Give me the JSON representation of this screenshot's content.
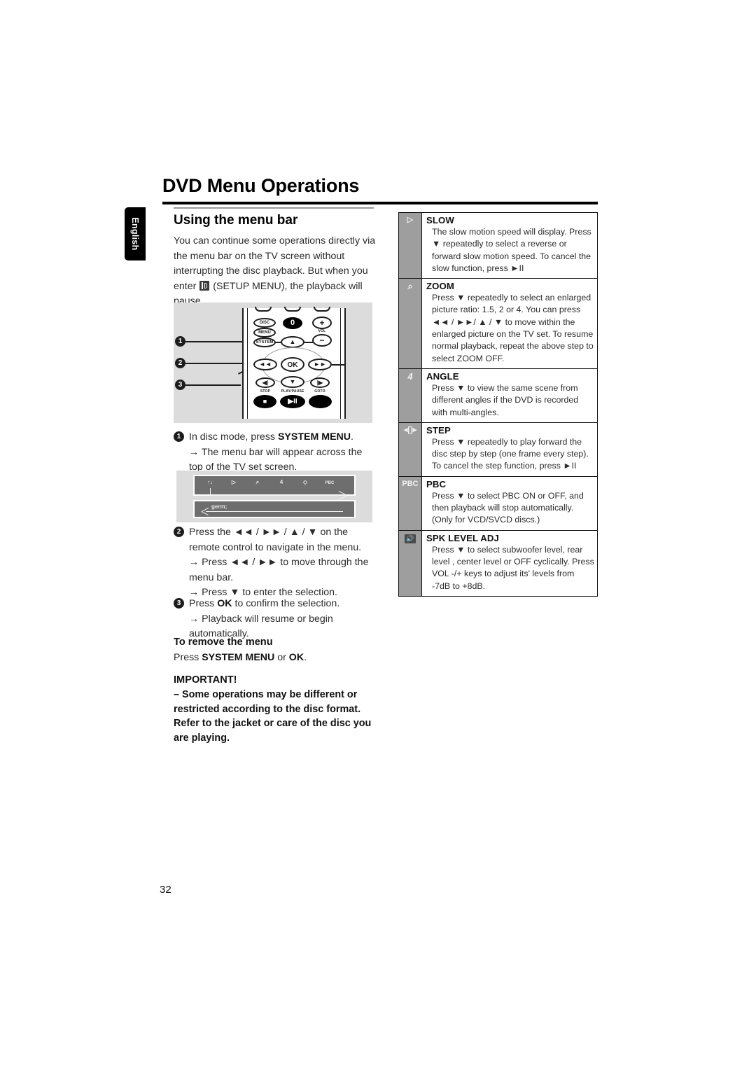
{
  "sidebar": {
    "language_tab": "English"
  },
  "header": {
    "title": "DVD Menu Operations"
  },
  "left": {
    "section_heading": "Using the menu bar",
    "intro_part1": "You can continue some operations directly via the menu bar on the TV screen without interrupting the disc playback. But when you enter",
    "intro_icon": "setup-menu-icon",
    "intro_part2": "(SETUP MENU), the playback will pause.",
    "remote_figure": {
      "name": "remote-control-illustration",
      "callouts": [
        "1",
        "2",
        "3"
      ],
      "buttons": [
        {
          "label": "DISC"
        },
        {
          "label": "MENU"
        },
        {
          "label": "SYSTEM"
        },
        {
          "label": "0"
        },
        {
          "label": "+"
        },
        {
          "label": "VOL"
        },
        {
          "label": "−"
        },
        {
          "label": "▲"
        },
        {
          "label": "◄◄"
        },
        {
          "label": "OK"
        },
        {
          "label": "►►"
        },
        {
          "label": "►►"
        },
        {
          "label": "▼"
        },
        {
          "label": "►▌"
        },
        {
          "label": "STOP"
        },
        {
          "label": "PLAY/PAUSE"
        },
        {
          "label": "GOTO"
        }
      ]
    },
    "steps": [
      {
        "num": "1",
        "text_main_pre": "In disc mode, press ",
        "text_main_bold": "SYSTEM MENU",
        "text_main_post": ".",
        "sub": [
          "→ The menu bar will appear across the top of the TV set screen."
        ]
      },
      {
        "num": "2",
        "text_main_pre": "Press the ◄◄ / ►► / ▲ / ▼ on the remote control to navigate in the menu.",
        "text_main_bold": "",
        "text_main_post": "",
        "sub": [
          "→ Press ◄◄ / ►► to move through the menu bar.",
          "→ Press ▼ to enter the selection."
        ]
      },
      {
        "num": "3",
        "text_main_pre": "Press ",
        "text_main_bold": "OK",
        "text_main_post": " to confirm the selection.",
        "sub": [
          "→ Playback will resume or begin automatically."
        ]
      }
    ],
    "menubar_figure": {
      "name": "osd-menu-bar-illustration",
      "icons": [
        "setup-icon",
        "slow-icon",
        "zoom-icon",
        "angle-icon",
        "step-icon",
        "pbc-icon"
      ],
      "icon_labels": [
        "↑↓",
        "▷",
        "⌕",
        "4",
        "◇",
        "PBC"
      ],
      "second_row_icon": "spk-level-icon"
    },
    "remove_menu": {
      "heading": "To remove the menu",
      "line_pre": "Press ",
      "line_bold1": "SYSTEM MENU",
      "line_mid": " or ",
      "line_bold2": "OK",
      "line_post": "."
    },
    "important": {
      "heading": "IMPORTANT!",
      "body": "–  Some operations may be different or restricted according to the disc format. Refer to the jacket or care of the disc you are playing."
    }
  },
  "table": {
    "name": "menu-bar-functions-table",
    "rows": [
      {
        "icon": "slow-icon",
        "icon_glyph": "▷",
        "title": "SLOW",
        "desc": "The slow motion speed will display. Press ▼ repeatedly to select a reverse or forward slow motion speed. To cancel the slow function, press ►II"
      },
      {
        "icon": "zoom-icon",
        "icon_glyph": "⌕",
        "title": "ZOOM",
        "desc": "Press ▼ repeatedly to select an enlarged picture ratio: 1.5, 2 or 4.  You can press ◄◄ / ►►/ ▲ / ▼ to move within the enlarged picture on the TV set. To resume normal playback, repeat the above step to select ZOOM OFF."
      },
      {
        "icon": "angle-icon",
        "icon_glyph": "4",
        "title": "ANGLE",
        "desc": "Press ▼ to view the same scene from different angles  if the DVD is recorded with multi-angles."
      },
      {
        "icon": "step-icon",
        "icon_glyph": "◇",
        "title": "STEP",
        "desc": "Press ▼ repeatedly to play forward the disc step by step (one frame every step). To cancel the step function, press ►II"
      },
      {
        "icon": "pbc-icon",
        "icon_glyph": "PBC",
        "title": "PBC",
        "desc": "Press ▼ to select PBC ON or OFF, and then playback will stop automatically.  (Only for VCD/SVCD discs.)"
      },
      {
        "icon": "speaker-level-icon",
        "icon_glyph": "◂))",
        "title": "SPK LEVEL ADJ",
        "desc": "Press ▼ to select subwoofer level, rear level , center level or OFF cyclically.  Press VOL -/+ keys to adjust its' levels from -7dB to +8dB."
      }
    ]
  },
  "footer": {
    "page_number": "32"
  }
}
